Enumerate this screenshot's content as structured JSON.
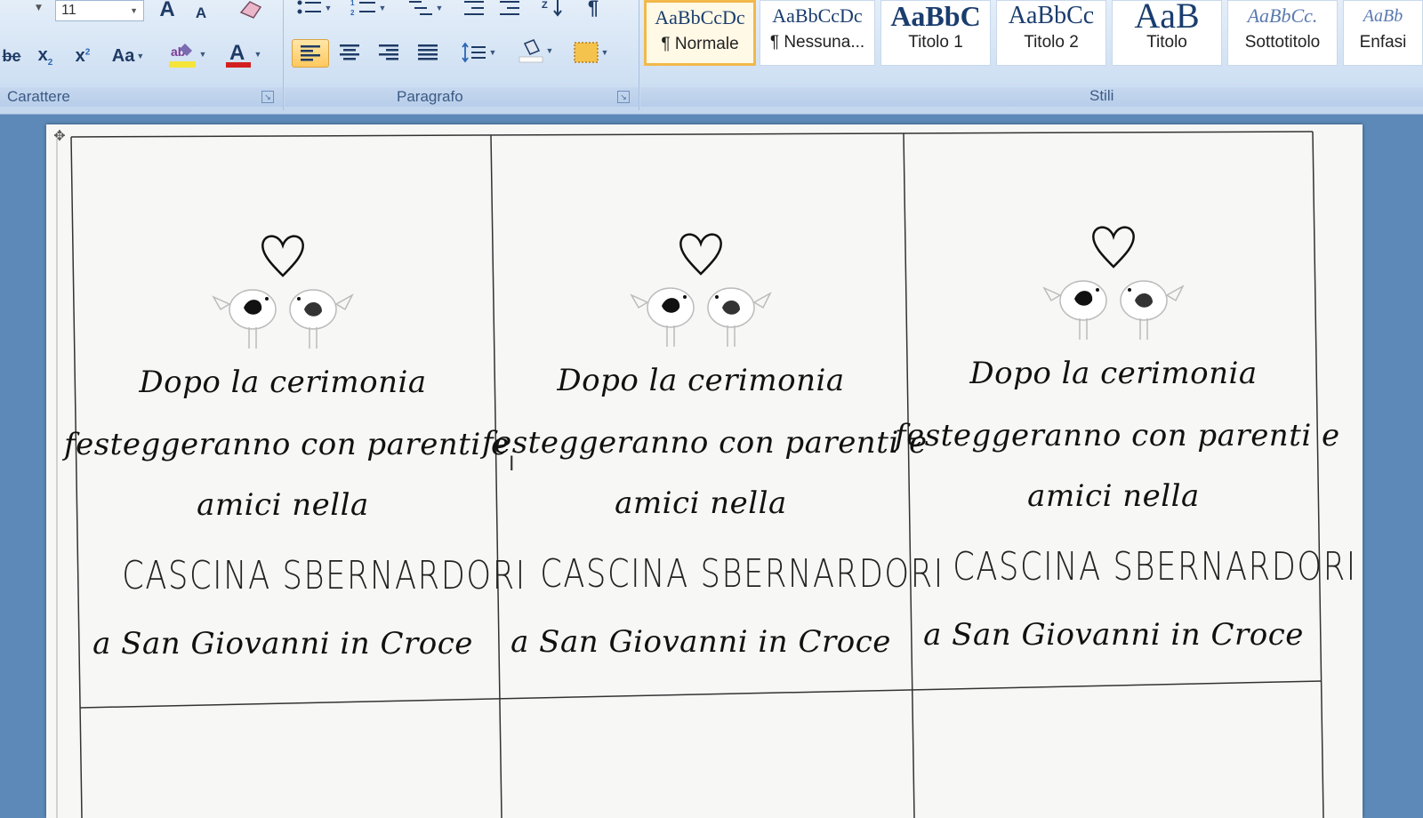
{
  "ribbon": {
    "font_size": "11",
    "groups": {
      "carattere": "Carattere",
      "paragrafo": "Paragrafo",
      "stili": "Stili"
    },
    "styles": [
      {
        "sample": "AaBbCcDc",
        "name": "¶ Normale",
        "selected": true
      },
      {
        "sample": "AaBbCcDc",
        "name": "¶ Nessuna...",
        "selected": false
      },
      {
        "sample": "AaBbC",
        "name": "Titolo 1",
        "selected": false
      },
      {
        "sample": "AaBbCc",
        "name": "Titolo 2",
        "selected": false
      },
      {
        "sample": "AaB",
        "name": "Titolo",
        "selected": false
      },
      {
        "sample": "AaBbCc.",
        "name": "Sottotitolo",
        "selected": false
      },
      {
        "sample": "AaBb",
        "name": "Enfasi",
        "selected": false
      }
    ],
    "font_color": "#d21f1f",
    "highlight_color": "#f5e53a"
  },
  "document": {
    "cards": [
      {
        "line1": "Dopo la cerimonia",
        "line2": "festeggeranno con parenti e",
        "line3": "amici nella",
        "venue": "CASCINA SBERNARDORI",
        "location": "a San Giovanni in Croce"
      },
      {
        "line1": "Dopo la cerimonia",
        "line2": "festeggeranno con parenti e",
        "line3": "amici nella",
        "venue": "CASCINA SBERNARDORI",
        "location": "a San Giovanni in Croce"
      },
      {
        "line1": "Dopo la cerimonia",
        "line2": "festeggeranno con parenti e",
        "line3": "amici nella",
        "venue": "CASCINA SBERNARDORI",
        "location": "a San Giovanni in Croce"
      }
    ]
  }
}
